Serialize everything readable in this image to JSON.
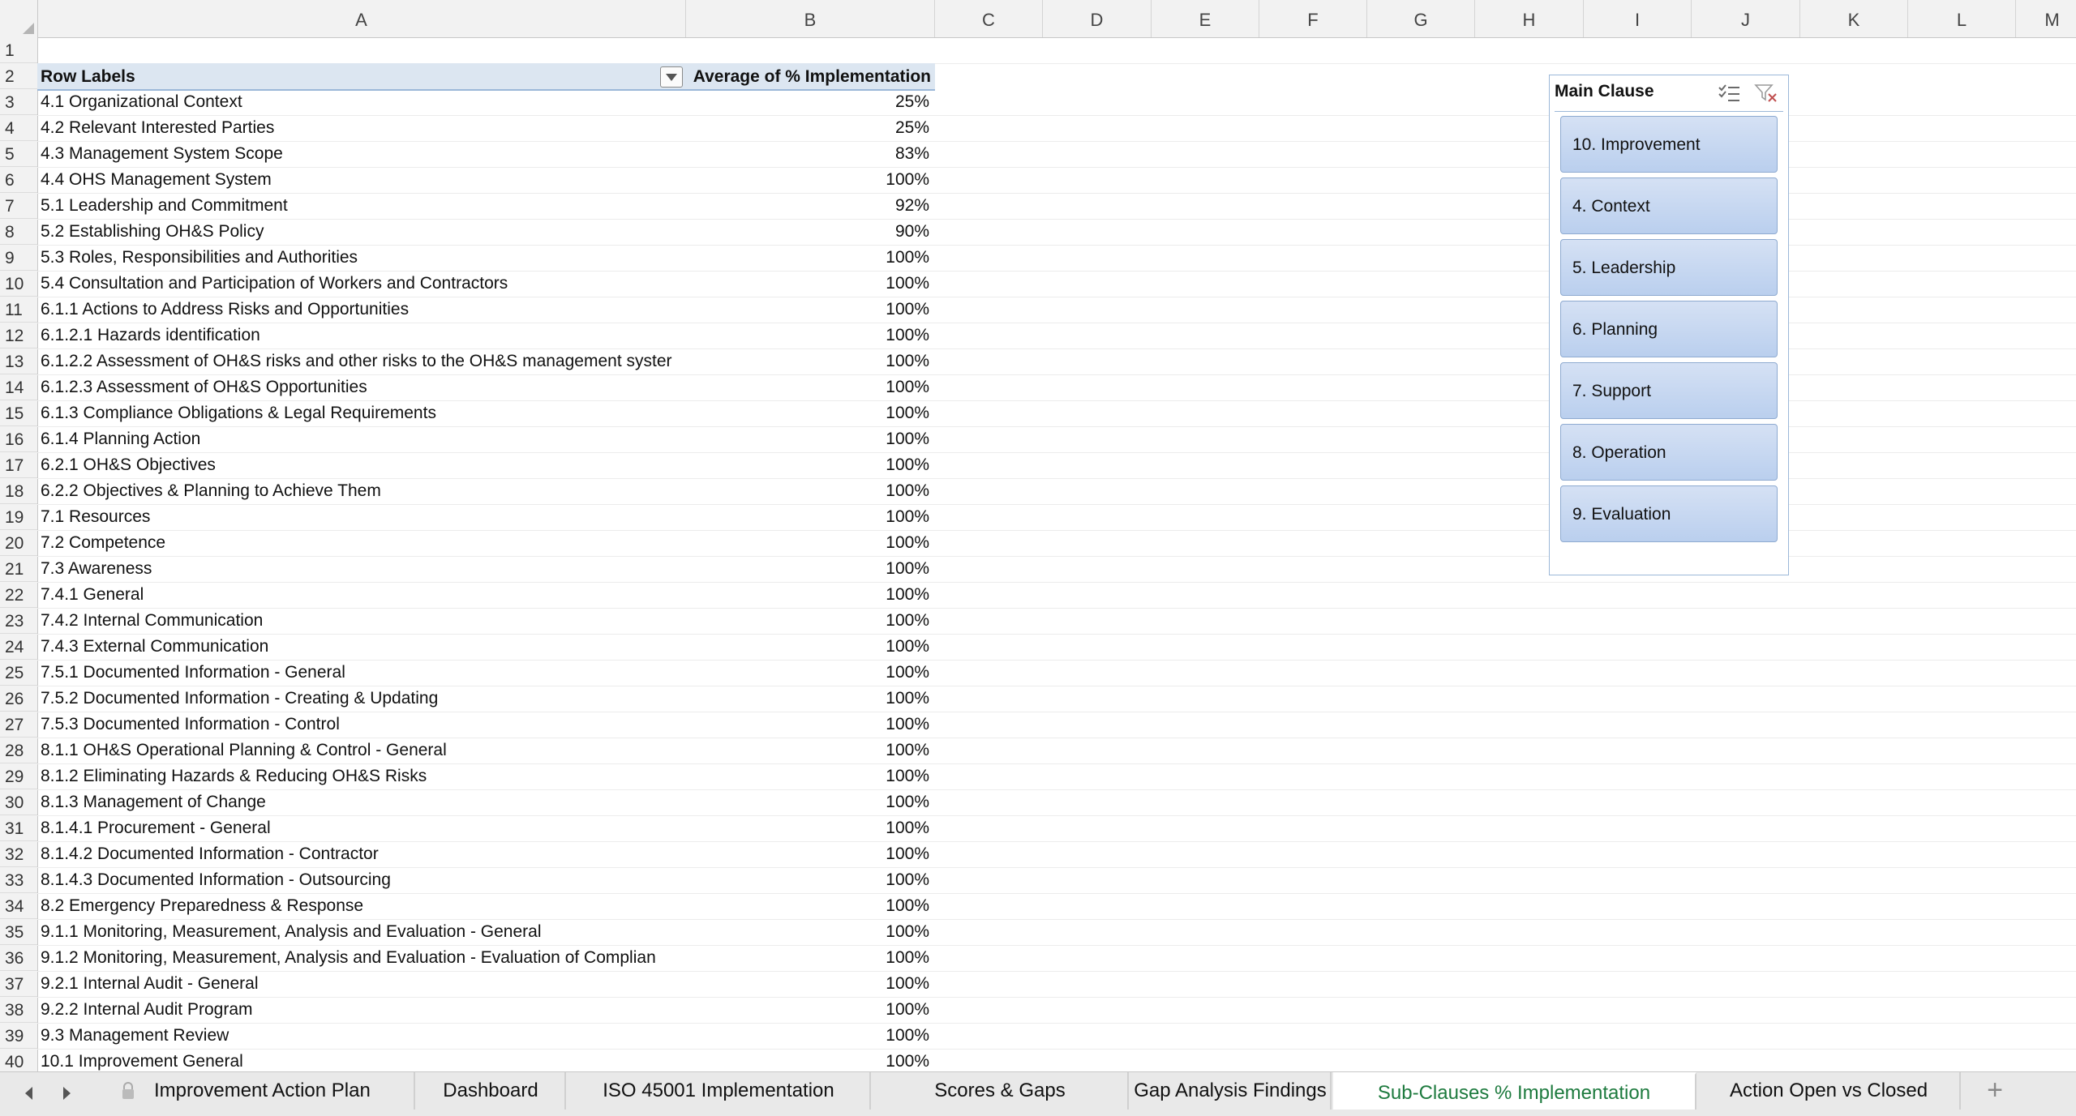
{
  "columns": [
    "A",
    "B",
    "C",
    "D",
    "E",
    "F",
    "G",
    "H",
    "I",
    "J",
    "K",
    "L",
    "M"
  ],
  "header_row": {
    "row_num": "2",
    "row_labels": "Row Labels",
    "value_header": "Average of % Implementation"
  },
  "blank_row_num": "1",
  "rows": [
    {
      "num": "3",
      "label": "4.1 Organizational Context",
      "value": "25%"
    },
    {
      "num": "4",
      "label": "4.2 Relevant Interested Parties",
      "value": "25%"
    },
    {
      "num": "5",
      "label": "4.3 Management System Scope",
      "value": "83%"
    },
    {
      "num": "6",
      "label": "4.4 OHS Management System",
      "value": "100%"
    },
    {
      "num": "7",
      "label": "5.1 Leadership and Commitment",
      "value": "92%"
    },
    {
      "num": "8",
      "label": "5.2 Establishing OH&S Policy",
      "value": "90%"
    },
    {
      "num": "9",
      "label": "5.3 Roles, Responsibilities and Authorities",
      "value": "100%"
    },
    {
      "num": "10",
      "label": "5.4 Consultation and Participation of Workers and Contractors",
      "value": "100%"
    },
    {
      "num": "11",
      "label": "6.1.1 Actions to Address Risks and Opportunities",
      "value": "100%"
    },
    {
      "num": "12",
      "label": "6.1.2.1 Hazards identification",
      "value": "100%"
    },
    {
      "num": "13",
      "label": "6.1.2.2 Assessment of OH&S risks and other risks to the OH&S management syster",
      "value": "100%"
    },
    {
      "num": "14",
      "label": "6.1.2.3 Assessment of OH&S Opportunities",
      "value": "100%"
    },
    {
      "num": "15",
      "label": "6.1.3 Compliance Obligations & Legal Requirements",
      "value": "100%"
    },
    {
      "num": "16",
      "label": "6.1.4 Planning Action",
      "value": "100%"
    },
    {
      "num": "17",
      "label": "6.2.1 OH&S Objectives",
      "value": "100%"
    },
    {
      "num": "18",
      "label": "6.2.2 Objectives & Planning to Achieve Them",
      "value": "100%"
    },
    {
      "num": "19",
      "label": "7.1 Resources",
      "value": "100%"
    },
    {
      "num": "20",
      "label": "7.2 Competence",
      "value": "100%"
    },
    {
      "num": "21",
      "label": "7.3 Awareness",
      "value": "100%"
    },
    {
      "num": "22",
      "label": "7.4.1 General",
      "value": "100%"
    },
    {
      "num": "23",
      "label": "7.4.2 Internal Communication",
      "value": "100%"
    },
    {
      "num": "24",
      "label": "7.4.3 External Communication",
      "value": "100%"
    },
    {
      "num": "25",
      "label": "7.5.1 Documented Information - General",
      "value": "100%"
    },
    {
      "num": "26",
      "label": "7.5.2 Documented Information - Creating & Updating",
      "value": "100%"
    },
    {
      "num": "27",
      "label": "7.5.3 Documented Information - Control",
      "value": "100%"
    },
    {
      "num": "28",
      "label": "8.1.1 OH&S Operational Planning & Control - General",
      "value": "100%"
    },
    {
      "num": "29",
      "label": "8.1.2 Eliminating Hazards & Reducing OH&S Risks",
      "value": "100%"
    },
    {
      "num": "30",
      "label": "8.1.3 Management of Change",
      "value": "100%"
    },
    {
      "num": "31",
      "label": "8.1.4.1 Procurement - General",
      "value": "100%"
    },
    {
      "num": "32",
      "label": "8.1.4.2 Documented Information - Contractor",
      "value": "100%"
    },
    {
      "num": "33",
      "label": "8.1.4.3 Documented Information - Outsourcing",
      "value": "100%"
    },
    {
      "num": "34",
      "label": "8.2 Emergency Preparedness & Response",
      "value": "100%"
    },
    {
      "num": "35",
      "label": "9.1.1 Monitoring, Measurement, Analysis and Evaluation - General",
      "value": "100%"
    },
    {
      "num": "36",
      "label": "9.1.2 Monitoring, Measurement, Analysis and Evaluation - Evaluation of Complian",
      "value": "100%"
    },
    {
      "num": "37",
      "label": "9.2.1 Internal Audit - General",
      "value": "100%"
    },
    {
      "num": "38",
      "label": "9.2.2 Internal Audit Program",
      "value": "100%"
    },
    {
      "num": "39",
      "label": "9.3 Management Review",
      "value": "100%"
    },
    {
      "num": "40",
      "label": "10.1 Improvement General",
      "value": "100%"
    }
  ],
  "slicer": {
    "title": "Main Clause",
    "multiselect_icon": "multi-select-icon",
    "clear_filter_icon": "clear-filter-icon",
    "items": [
      "10. Improvement",
      "4. Context",
      "5. Leadership",
      "6. Planning",
      "7. Support",
      "8. Operation",
      "9. Evaluation"
    ]
  },
  "tabs": [
    {
      "label": "Improvement Action Plan",
      "locked": true,
      "active": false
    },
    {
      "label": "Dashboard",
      "locked": false,
      "active": false
    },
    {
      "label": "ISO 45001 Implementation",
      "locked": false,
      "active": false
    },
    {
      "label": "Scores & Gaps",
      "locked": false,
      "active": false
    },
    {
      "label": "Gap Analysis Findings",
      "locked": false,
      "active": false
    },
    {
      "label": "Sub-Clauses % Implementation",
      "locked": false,
      "active": true
    },
    {
      "label": "Action Open vs Closed",
      "locked": false,
      "active": false
    }
  ],
  "add_tab_label": "+",
  "colors": {
    "active_tab_text": "#1d7a3e",
    "slicer_item": "#c7d8f1",
    "header_band": "#dce6f1"
  }
}
